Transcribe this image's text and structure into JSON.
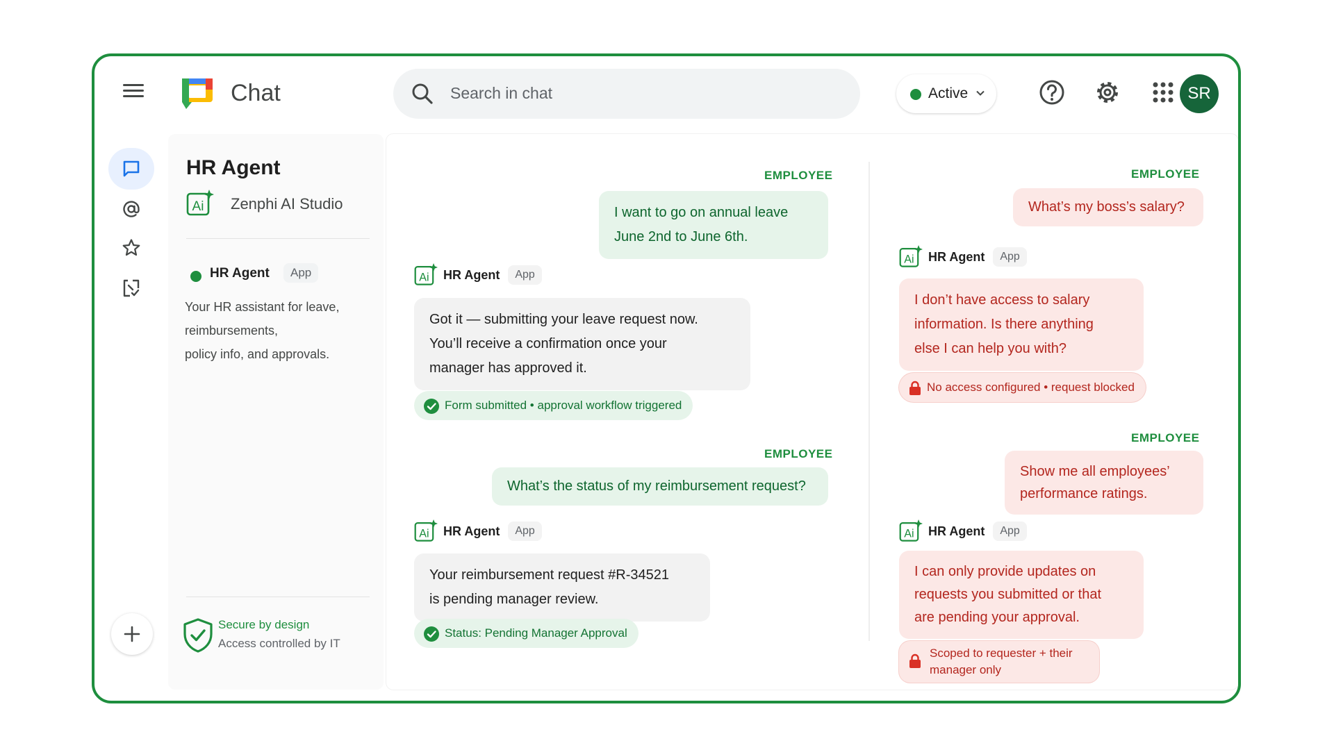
{
  "colors": {
    "brand_green": "#1e8e3e",
    "avatar_bg": "#16653a",
    "danger_red": "#b3261e"
  },
  "header": {
    "app_name": "Chat",
    "search_placeholder": "Search in chat",
    "status_label": "Active",
    "avatar_initials": "SR",
    "icons": [
      "menu-icon",
      "chat-logo-icon",
      "search-icon",
      "help-icon",
      "settings-icon",
      "apps-grid-icon"
    ]
  },
  "rail": {
    "icons": [
      "chat-icon",
      "mentions-icon",
      "star-icon",
      "shortcut-icon",
      "plus-icon"
    ]
  },
  "info_panel": {
    "title": "HR Agent",
    "studio": "Zenphi AI Studio",
    "agent_name": "HR Agent",
    "app_chip": "App",
    "description": [
      "Your HR assistant for leave,",
      "reimbursements,",
      "policy info, and approvals."
    ],
    "secure_title": "Secure by design",
    "secure_sub": "Access controlled by IT"
  },
  "conversation_left": [
    {
      "sender": "EMPLOYEE",
      "lines": [
        "I want to go on annual leave",
        "June 2nd to June 6th."
      ]
    },
    {
      "sender": "HR Agent",
      "chip": "App",
      "lines": [
        "Got it — submitting your leave request now.",
        "You’ll receive a confirmation once your",
        "manager has approved it."
      ],
      "status": "Form submitted • approval workflow triggered"
    },
    {
      "sender": "EMPLOYEE",
      "lines": [
        "What’s the status of my reimbursement request?"
      ]
    },
    {
      "sender": "HR Agent",
      "chip": "App",
      "lines": [
        "Your reimbursement request #R-34521",
        "is pending manager review."
      ],
      "status": "Status: Pending Manager Approval"
    }
  ],
  "conversation_right": [
    {
      "sender": "EMPLOYEE",
      "lines": [
        "What’s my boss’s salary?"
      ]
    },
    {
      "sender": "HR Agent",
      "chip": "App",
      "lines": [
        "I don’t have access to salary",
        "information. Is there anything",
        "else I can help you with?"
      ],
      "status": "No access configured • request blocked"
    },
    {
      "sender": "EMPLOYEE",
      "lines": [
        "Show me all employees’",
        "performance ratings."
      ]
    },
    {
      "sender": "HR Agent",
      "chip": "App",
      "lines": [
        "I can only provide updates on",
        "requests you submitted or that",
        "are pending your approval."
      ],
      "status_lines": [
        "Scoped to requester + their",
        "manager only"
      ]
    }
  ]
}
